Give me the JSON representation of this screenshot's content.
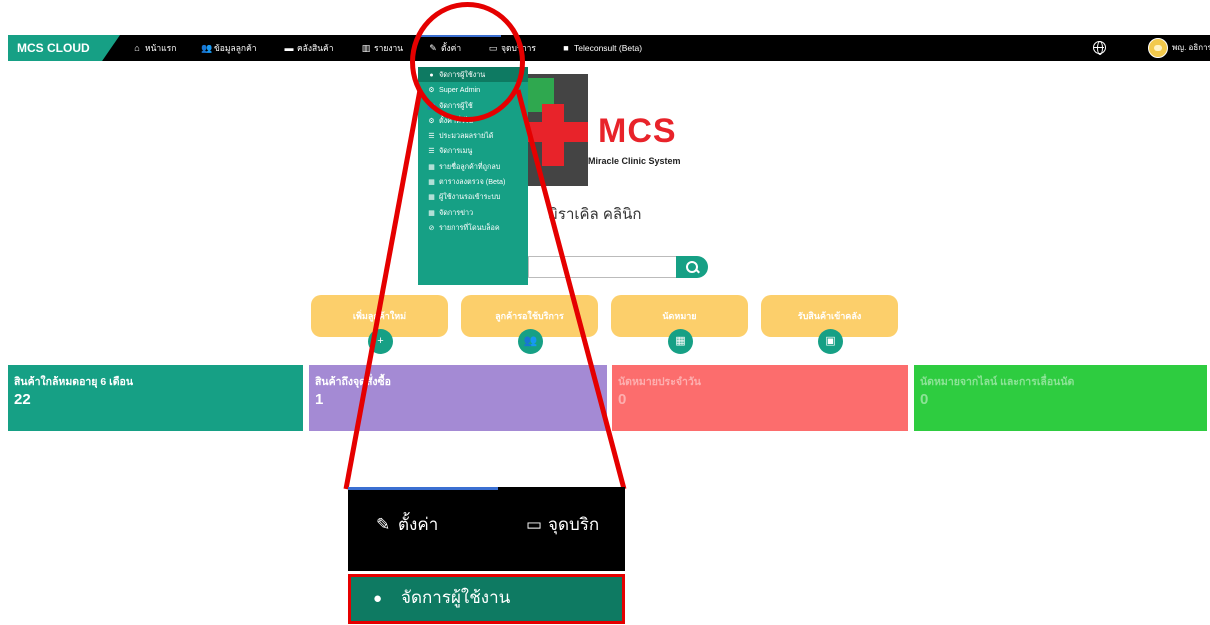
{
  "nav": {
    "brand": "MCS CLOUD",
    "items": [
      {
        "label": "หน้าแรก",
        "icon": "home-icon",
        "glyph": "⌂"
      },
      {
        "label": "ข้อมูลลูกค้า",
        "icon": "users-icon",
        "glyph": "👥"
      },
      {
        "label": "คลังสินค้า",
        "icon": "archive-icon",
        "glyph": "▬"
      },
      {
        "label": "รายงาน",
        "icon": "bar-chart-icon",
        "glyph": "▥"
      },
      {
        "label": "ตั้งค่า",
        "icon": "wrench-icon",
        "glyph": "✎"
      },
      {
        "label": "จุดบริการ",
        "icon": "monitor-icon",
        "glyph": "▭"
      },
      {
        "label": "Teleconsult (Beta)",
        "icon": "video-camera-icon",
        "glyph": "■"
      }
    ],
    "user_name": "พญ. อธิการ"
  },
  "dropdown": {
    "items": [
      {
        "label": "จัดการผู้ใช้งาน",
        "icon": "user-icon",
        "glyph": "●"
      },
      {
        "label": "Super Admin",
        "icon": "cogs-icon",
        "glyph": "⚙"
      },
      {
        "label": "จัดการผู้ใช้",
        "icon": "users-icon",
        "glyph": "👥"
      },
      {
        "label": "ตั้งค่าทั่วไป",
        "icon": "cogs-icon",
        "glyph": "⚙"
      },
      {
        "label": "ประมวลผลรายได้",
        "icon": "list-icon",
        "glyph": "☰"
      },
      {
        "label": "จัดการเมนู",
        "icon": "list-icon",
        "glyph": "☰"
      },
      {
        "label": "รายชื่อลูกค้าที่ถูกลบ",
        "icon": "table-icon",
        "glyph": "▦"
      },
      {
        "label": "ตารางลงตรวจ (Beta)",
        "icon": "table-icon",
        "glyph": "▦"
      },
      {
        "label": "ผู้ใช้งานรอเข้าระบบ",
        "icon": "table-icon",
        "glyph": "▦"
      },
      {
        "label": "จัดการข่าว",
        "icon": "table-icon",
        "glyph": "▦"
      },
      {
        "label": "รายการที่โดนบล็อค",
        "icon": "ban-icon",
        "glyph": "⊘"
      }
    ]
  },
  "logo": {
    "title": "MCS",
    "subtitle": "Miracle Clinic System"
  },
  "clinic_name": "มิราเคิล คลินิก",
  "search": {
    "value": ""
  },
  "quick_actions": [
    {
      "label": "เพิ่มลูกค้าใหม่",
      "icon": "user-plus-icon",
      "glyph": "+"
    },
    {
      "label": "ลูกค้ารอใช้บริการ",
      "icon": "users-icon",
      "glyph": "👥"
    },
    {
      "label": "นัดหมาย",
      "icon": "calendar-icon",
      "glyph": "▦"
    },
    {
      "label": "รับสินค้าเข้าคลัง",
      "icon": "archive-icon",
      "glyph": "▣"
    }
  ],
  "cards": [
    {
      "title": "สินค้าใกล้หมดอายุ 6 เดือน",
      "value": "22"
    },
    {
      "title": "สินค้าถึงจุดสั่งซื้อ",
      "value": "1"
    },
    {
      "title": "นัดหมายประจำวัน",
      "value": "0"
    },
    {
      "title": "นัดหมายจากไลน์ และการเลื่อนนัด",
      "value": "0"
    }
  ],
  "zoom": {
    "tab1": {
      "label": "ตั้งค่า",
      "glyph": "✎"
    },
    "tab2": {
      "label": "จุดบริก",
      "glyph": "▭"
    },
    "item": {
      "label": "จัดการผู้ใช้งาน",
      "glyph": "●"
    }
  },
  "colors": {
    "brand": "#16a085",
    "dropdown_active": "#0e7a62",
    "quick_button": "#fccf6b",
    "card_green": "#16a085",
    "card_purple": "#a48ad4",
    "card_red": "#fc6d6d",
    "card_lime": "#2ecc40",
    "highlight": "#e50000"
  }
}
